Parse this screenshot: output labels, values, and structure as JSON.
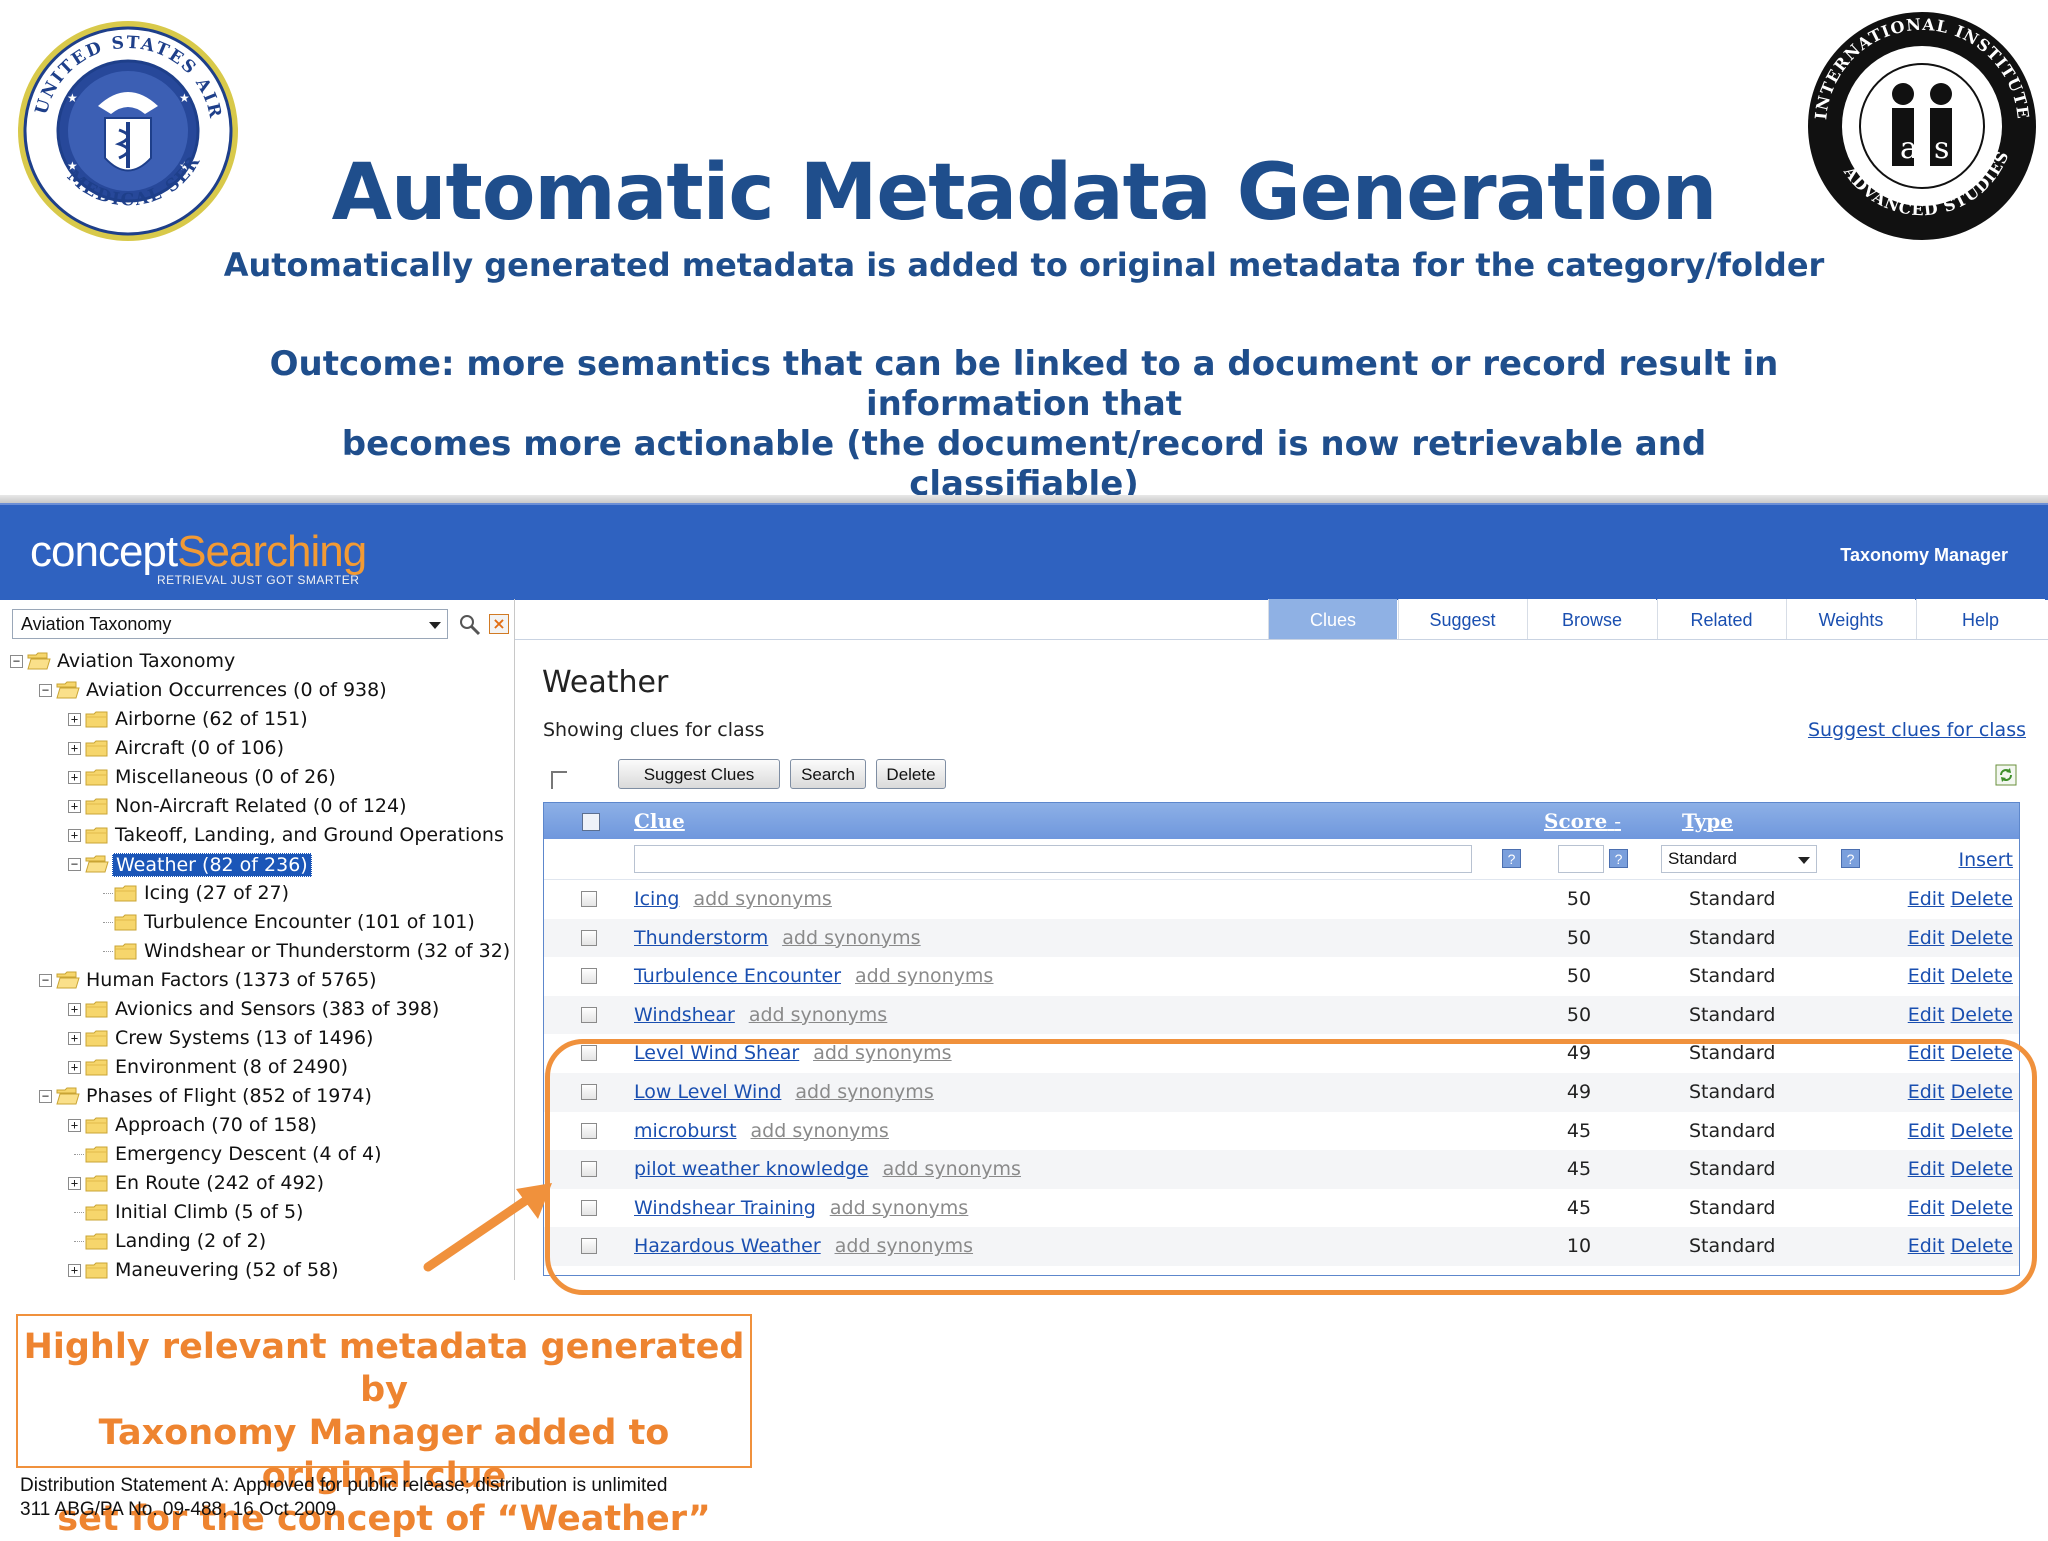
{
  "slide": {
    "title": "Automatic Metadata Generation",
    "subtitle": "Automatically generated metadata is added to original metadata for the category/folder",
    "outcome_line1": "Outcome: more semantics that can be linked to a document or record result in information that",
    "outcome_line2": "becomes more actionable (the document/record is now retrievable and classifiable)",
    "callout": [
      "Highly relevant metadata generated by",
      "Taxonomy Manager added to original clue",
      "set for the concept of “Weather”"
    ],
    "footer_line1": "Distribution Statement A: Approved for public release; distribution is unlimited",
    "footer_line2": "311 ABG/PA No. 09-488, 16 Oct 2009",
    "accent_color": "#f0913c",
    "title_color": "#1f4e8c",
    "logo_left": "us-air-force-medical-service-seal",
    "logo_right": "international-institute-for-advanced-studies-seal"
  },
  "app": {
    "brand_part1": "concept",
    "brand_part2": "Searching",
    "tagline": "RETRIEVAL JUST GOT SMARTER",
    "product": "Taxonomy Manager",
    "banner_color": "#2f62c0",
    "taxonomy_select": "Aviation Taxonomy",
    "tabs": [
      {
        "label": "Clues",
        "active": true
      },
      {
        "label": "Suggest",
        "active": false
      },
      {
        "label": "Browse",
        "active": false
      },
      {
        "label": "Related",
        "active": false
      },
      {
        "label": "Weights",
        "active": false
      },
      {
        "label": "Help",
        "active": false
      }
    ],
    "tree": [
      {
        "label": "Aviation Taxonomy",
        "level": 0,
        "toggle": "minus",
        "selected": false
      },
      {
        "label": "Aviation Occurrences (0 of 938)",
        "level": 1,
        "toggle": "minus",
        "selected": false
      },
      {
        "label": "Airborne (62 of 151)",
        "level": 2,
        "toggle": "plus",
        "selected": false
      },
      {
        "label": "Aircraft (0 of 106)",
        "level": 2,
        "toggle": "plus",
        "selected": false
      },
      {
        "label": "Miscellaneous (0 of 26)",
        "level": 2,
        "toggle": "plus",
        "selected": false
      },
      {
        "label": "Non-Aircraft Related (0 of 124)",
        "level": 2,
        "toggle": "plus",
        "selected": false
      },
      {
        "label": "Takeoff, Landing, and Ground Operations",
        "level": 2,
        "toggle": "plus",
        "selected": false
      },
      {
        "label": "Weather (82 of 236)",
        "level": 2,
        "toggle": "minus",
        "selected": true
      },
      {
        "label": "Icing (27 of 27)",
        "level": 3,
        "toggle": "none",
        "selected": false
      },
      {
        "label": "Turbulence Encounter (101 of 101)",
        "level": 3,
        "toggle": "none",
        "selected": false
      },
      {
        "label": "Windshear or Thunderstorm (32 of 32)",
        "level": 3,
        "toggle": "none",
        "selected": false
      },
      {
        "label": "Human Factors (1373 of 5765)",
        "level": 1,
        "toggle": "minus",
        "selected": false
      },
      {
        "label": "Avionics and Sensors (383 of 398)",
        "level": 2,
        "toggle": "plus",
        "selected": false
      },
      {
        "label": "Crew Systems (13 of 1496)",
        "level": 2,
        "toggle": "plus",
        "selected": false
      },
      {
        "label": "Environment (8 of 2490)",
        "level": 2,
        "toggle": "plus",
        "selected": false
      },
      {
        "label": "Phases of Flight (852 of 1974)",
        "level": 1,
        "toggle": "minus",
        "selected": false
      },
      {
        "label": "Approach (70 of 158)",
        "level": 2,
        "toggle": "plus",
        "selected": false
      },
      {
        "label": "Emergency Descent (4 of 4)",
        "level": 2,
        "toggle": "none",
        "selected": false
      },
      {
        "label": "En Route (242 of 492)",
        "level": 2,
        "toggle": "plus",
        "selected": false
      },
      {
        "label": "Initial Climb (5 of 5)",
        "level": 2,
        "toggle": "none",
        "selected": false
      },
      {
        "label": "Landing (2 of 2)",
        "level": 2,
        "toggle": "none",
        "selected": false
      },
      {
        "label": "Maneuvering (52 of 58)",
        "level": 2,
        "toggle": "plus",
        "selected": false
      }
    ],
    "class_title": "Weather",
    "showing": "Showing clues for class",
    "suggest_link": "Suggest clues for class",
    "buttons": {
      "suggest": "Suggest Clues",
      "search": "Search",
      "delete": "Delete"
    },
    "grid": {
      "col_clue": "Clue",
      "col_score": "Score",
      "col_score_sort": "-",
      "col_type": "Type",
      "new_type": "Standard",
      "help": "?",
      "insert": "Insert",
      "add_synonyms": "add synonyms",
      "edit": "Edit",
      "delete": "Delete",
      "rows": [
        {
          "clue": "Icing",
          "score": "50",
          "type": "Standard"
        },
        {
          "clue": "Thunderstorm",
          "score": "50",
          "type": "Standard"
        },
        {
          "clue": "Turbulence Encounter",
          "score": "50",
          "type": "Standard"
        },
        {
          "clue": "Windshear",
          "score": "50",
          "type": "Standard"
        },
        {
          "clue": "Level Wind Shear",
          "score": "49",
          "type": "Standard"
        },
        {
          "clue": "Low Level Wind",
          "score": "49",
          "type": "Standard"
        },
        {
          "clue": "microburst",
          "score": "45",
          "type": "Standard"
        },
        {
          "clue": "pilot weather knowledge",
          "score": "45",
          "type": "Standard"
        },
        {
          "clue": "Windshear Training",
          "score": "45",
          "type": "Standard"
        },
        {
          "clue": "Hazardous Weather",
          "score": "10",
          "type": "Standard"
        }
      ]
    }
  }
}
